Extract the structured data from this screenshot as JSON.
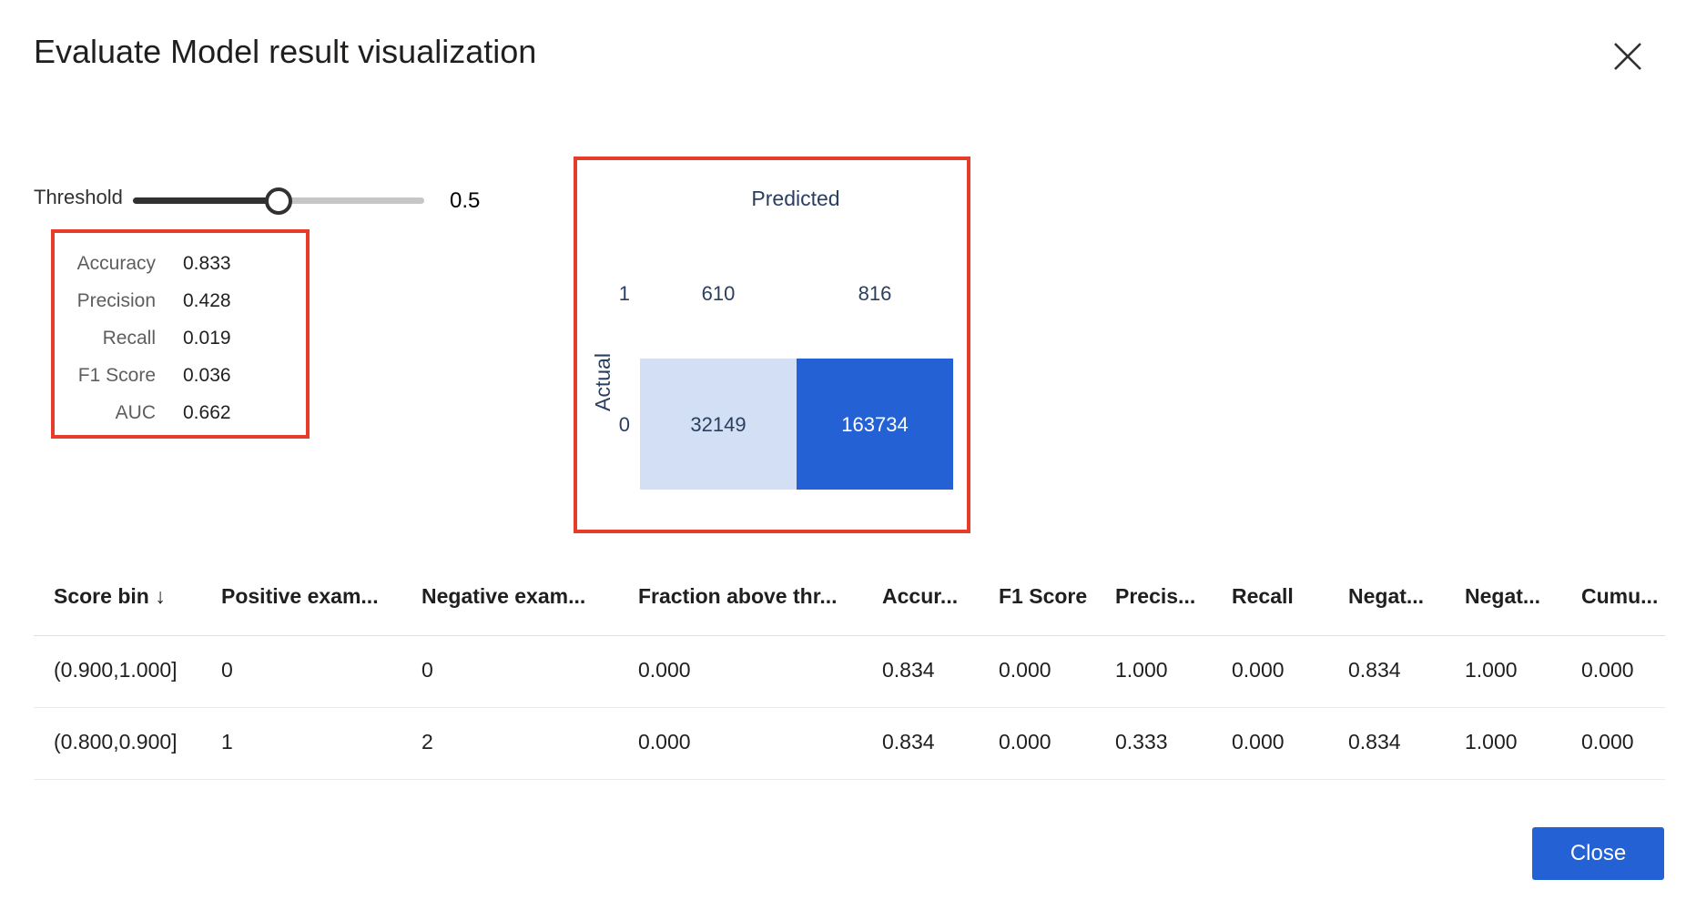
{
  "dialog": {
    "title": "Evaluate Model result visualization",
    "close_icon": "close-icon",
    "close_button_label": "Close",
    "accent_color": "#2461d5"
  },
  "threshold": {
    "label": "Threshold",
    "value": "0.5",
    "fraction": 0.5
  },
  "metrics": [
    {
      "label": "Accuracy",
      "value": "0.833"
    },
    {
      "label": "Precision",
      "value": "0.428"
    },
    {
      "label": "Recall",
      "value": "0.019"
    },
    {
      "label": "F1 Score",
      "value": "0.036"
    },
    {
      "label": "AUC",
      "value": "0.662"
    }
  ],
  "confusion_matrix": {
    "predicted_label": "Predicted",
    "actual_label": "Actual",
    "predicted_ticks": [
      "1",
      "0"
    ],
    "actual_ticks": [
      "1",
      "0"
    ],
    "cells": [
      [
        "610",
        "816"
      ],
      [
        "32149",
        "163734"
      ]
    ],
    "cell_colors": [
      [
        "#ffffff",
        "#ffffff"
      ],
      [
        "#d2dff5",
        "#2461d5"
      ]
    ],
    "cell_text_colors": [
      [
        "#2a3f5f",
        "#2a3f5f"
      ],
      [
        "#2a3f5f",
        "#ffffff"
      ]
    ]
  },
  "table": {
    "columns": [
      "Score bin ↓",
      "Positive exam...",
      "Negative exam...",
      "Fraction above thr...",
      "Accur...",
      "F1 Score",
      "Precis...",
      "Recall",
      "Negat...",
      "Negat...",
      "Cumu..."
    ],
    "rows": [
      [
        "(0.900,1.000]",
        "0",
        "0",
        "0.000",
        "0.834",
        "0.000",
        "1.000",
        "0.000",
        "0.834",
        "1.000",
        "0.000"
      ],
      [
        "(0.800,0.900]",
        "1",
        "2",
        "0.000",
        "0.834",
        "0.000",
        "0.333",
        "0.000",
        "0.834",
        "1.000",
        "0.000"
      ]
    ]
  }
}
